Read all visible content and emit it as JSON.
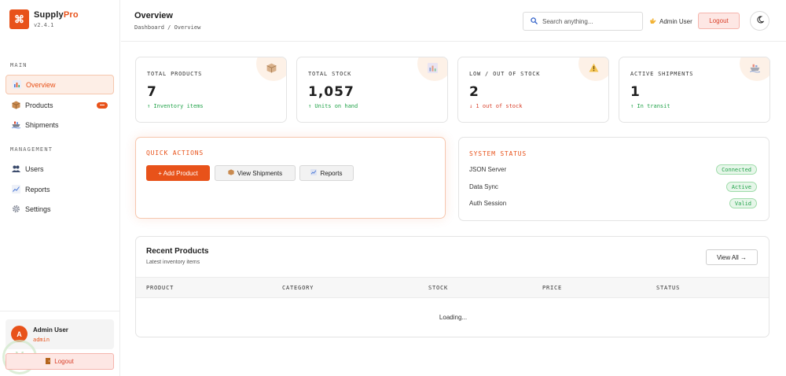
{
  "brand": {
    "name_part1": "Supply",
    "name_part2": "Pro",
    "version": "v2.4.1",
    "accent": "#e8521a"
  },
  "sidebar": {
    "section_main": "MAIN",
    "section_management": "MANAGEMENT",
    "items": [
      {
        "label": "Overview",
        "icon": "chart-icon",
        "active": true
      },
      {
        "label": "Products",
        "icon": "package-icon"
      },
      {
        "label": "Shipments",
        "icon": "ship-icon"
      },
      {
        "label": "Users",
        "icon": "users-icon"
      },
      {
        "label": "Reports",
        "icon": "line-chart-icon"
      },
      {
        "label": "Settings",
        "icon": "gear-icon"
      }
    ],
    "user": {
      "initial": "A",
      "name": "Admin User",
      "role": "admin"
    },
    "logout_label": "Logout"
  },
  "header": {
    "title": "Overview",
    "breadcrumb": "Dashboard / Overview",
    "search_placeholder": "Search anything...",
    "user_label": "Admin User",
    "logout_label": "Logout"
  },
  "stats": [
    {
      "label": "TOTAL PRODUCTS",
      "value": "7",
      "sub": "↑ Inventory items",
      "tone": "green",
      "icon": "package-icon"
    },
    {
      "label": "TOTAL STOCK",
      "value": "1,057",
      "sub": "↑ Units on hand",
      "tone": "green",
      "icon": "bar-chart-icon"
    },
    {
      "label": "LOW / OUT OF STOCK",
      "value": "2",
      "sub": "↓ 1 out of stock",
      "tone": "red",
      "icon": "warning-icon"
    },
    {
      "label": "ACTIVE SHIPMENTS",
      "value": "1",
      "sub": "↑ In transit",
      "tone": "green",
      "icon": "ship-icon"
    }
  ],
  "quick_actions": {
    "title": "QUICK ACTIONS",
    "add_product": "+ Add Product",
    "view_shipments": "View Shipments",
    "reports": "Reports"
  },
  "system_status": {
    "title": "SYSTEM STATUS",
    "rows": [
      {
        "label": "JSON Server",
        "status": "Connected"
      },
      {
        "label": "Data Sync",
        "status": "Active"
      },
      {
        "label": "Auth Session",
        "status": "Valid"
      }
    ]
  },
  "recent_products": {
    "title": "Recent Products",
    "subtitle": "Latest inventory items",
    "view_all": "View All →",
    "columns": [
      "PRODUCT",
      "CATEGORY",
      "STOCK",
      "PRICE",
      "STATUS"
    ],
    "loading": "Loading..."
  }
}
